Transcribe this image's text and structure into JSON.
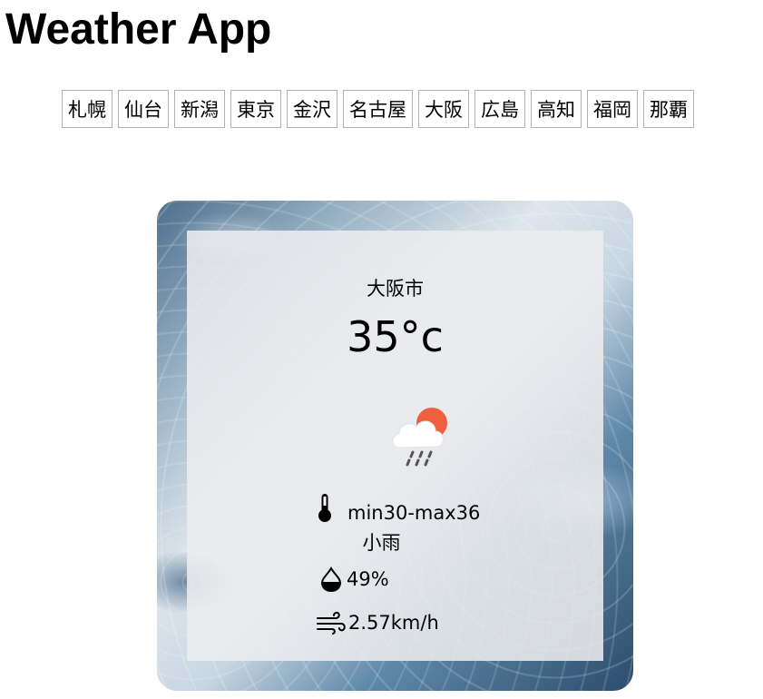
{
  "app": {
    "title": "Weather App"
  },
  "city_tabs": [
    {
      "label": "札幌"
    },
    {
      "label": "仙台"
    },
    {
      "label": "新潟"
    },
    {
      "label": "東京"
    },
    {
      "label": "金沢"
    },
    {
      "label": "名古屋"
    },
    {
      "label": "大阪"
    },
    {
      "label": "広島"
    },
    {
      "label": "高知"
    },
    {
      "label": "福岡"
    },
    {
      "label": "那覇"
    }
  ],
  "weather": {
    "city": "大阪市",
    "temperature": "35°c",
    "condition_icon": "sun-behind-rain-cloud-icon",
    "min_max": "min30-max36",
    "description": "小雨",
    "humidity": "49%",
    "wind": "2.57km/h"
  },
  "colors": {
    "sun": "#f0603f",
    "cloud": "#ffffff",
    "rain": "#555555",
    "panel": "#ececee"
  }
}
